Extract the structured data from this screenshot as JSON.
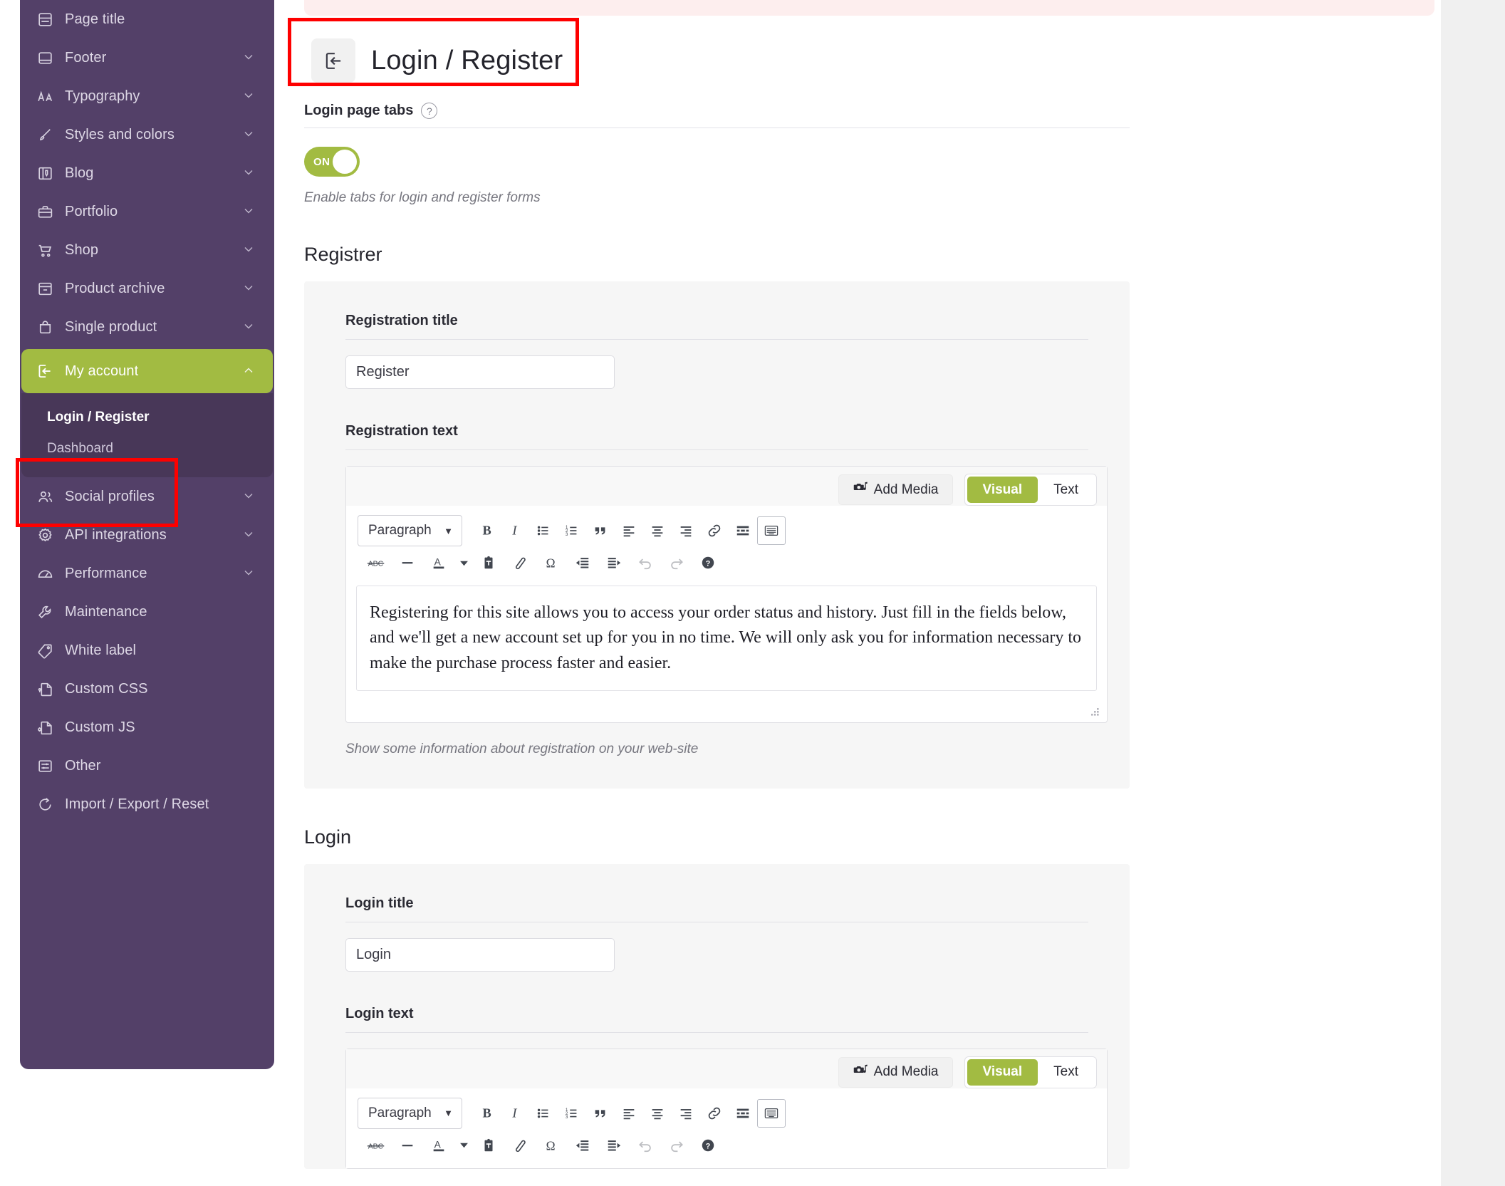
{
  "colors": {
    "sidebar_bg": "#534068",
    "submenu_bg": "#483758",
    "accent_green": "#a2bb42",
    "annotation_red": "#fe0000",
    "notice_pink": "#fdeeee",
    "card_bg": "#f6f6f6"
  },
  "sidebar": {
    "items": [
      {
        "label": "Page title",
        "icon": "page-title-icon",
        "expandable": false
      },
      {
        "label": "Footer",
        "icon": "footer-icon",
        "expandable": true
      },
      {
        "label": "Typography",
        "icon": "typography-icon",
        "expandable": true
      },
      {
        "label": "Styles and colors",
        "icon": "brush-icon",
        "expandable": true
      },
      {
        "label": "Blog",
        "icon": "blog-icon",
        "expandable": true
      },
      {
        "label": "Portfolio",
        "icon": "briefcase-icon",
        "expandable": true
      },
      {
        "label": "Shop",
        "icon": "cart-icon",
        "expandable": true
      },
      {
        "label": "Product archive",
        "icon": "archive-icon",
        "expandable": true
      },
      {
        "label": "Single product",
        "icon": "bag-icon",
        "expandable": true
      }
    ],
    "active_item": {
      "label": "My account",
      "icon": "login-icon",
      "expanded": true
    },
    "submenu": [
      {
        "label": "Login / Register",
        "current": true
      },
      {
        "label": "Dashboard",
        "current": false
      }
    ],
    "items_after": [
      {
        "label": "Social profiles",
        "icon": "users-icon",
        "expandable": true
      },
      {
        "label": "API integrations",
        "icon": "gear-icon",
        "expandable": true
      },
      {
        "label": "Performance",
        "icon": "gauge-icon",
        "expandable": true
      },
      {
        "label": "Maintenance",
        "icon": "wrench-icon",
        "expandable": false
      },
      {
        "label": "White label",
        "icon": "tag-icon",
        "expandable": false
      },
      {
        "label": "Custom CSS",
        "icon": "css-file-icon",
        "expandable": false
      },
      {
        "label": "Custom JS",
        "icon": "js-file-icon",
        "expandable": false
      },
      {
        "label": "Other",
        "icon": "sliders-icon",
        "expandable": false
      },
      {
        "label": "Import / Export / Reset",
        "icon": "refresh-icon",
        "expandable": false
      }
    ]
  },
  "header": {
    "icon": "login-icon",
    "title": "Login / Register"
  },
  "login_page_tabs": {
    "label": "Login page tabs",
    "help_icon": "question-mark-icon",
    "toggle_value": "ON",
    "toggle_on": true,
    "hint": "Enable tabs for login and register forms"
  },
  "register_section": {
    "title": "Registrer",
    "title_field": {
      "label": "Registration title",
      "value": "Register"
    },
    "text_field": {
      "label": "Registration text",
      "content": "Registering for this site allows you to access your order status and history. Just fill in the fields below, and we'll get a new account set up for you in no time. We will only ask you for information necessary to make the purchase process faster and easier.",
      "hint": "Show some information about registration on your web-site"
    }
  },
  "login_section": {
    "title": "Login",
    "title_field": {
      "label": "Login title",
      "value": "Login"
    },
    "text_field": {
      "label": "Login text"
    }
  },
  "editor": {
    "add_media_label": "Add Media",
    "add_media_icon": "add-media-icon",
    "visual_label": "Visual",
    "text_label": "Text",
    "format_select": "Paragraph",
    "toolbar_row1": [
      "bold-icon",
      "italic-icon",
      "bulleted-list-icon",
      "numbered-list-icon",
      "blockquote-icon",
      "align-left-icon",
      "align-center-icon",
      "align-right-icon",
      "link-icon",
      "read-more-icon",
      "toggle-toolbar-icon"
    ],
    "toolbar_row2": [
      "strikethrough-icon",
      "horizontal-rule-icon",
      "text-color-icon",
      "color-caret-icon",
      "paste-as-text-icon",
      "clear-formatting-icon",
      "special-character-icon",
      "outdent-icon",
      "indent-icon",
      "undo-icon",
      "redo-icon",
      "keyboard-shortcuts-icon"
    ]
  }
}
